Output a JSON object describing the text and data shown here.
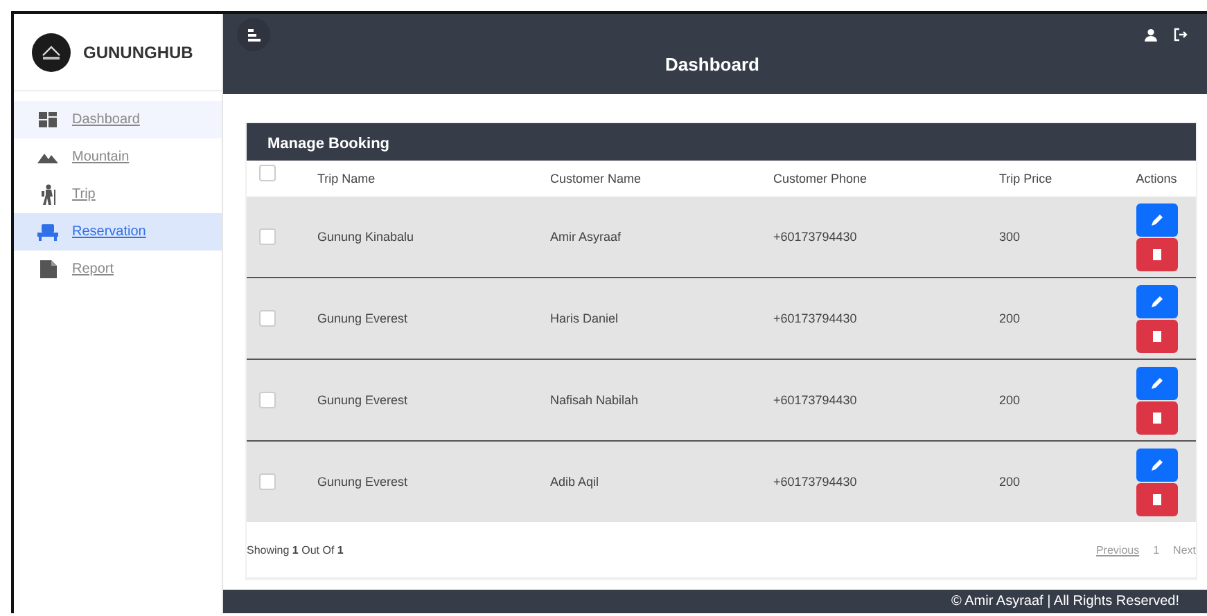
{
  "sidebar": {
    "brand": "GUNUNGHUB",
    "items": [
      {
        "kind": "dashboard",
        "label": "Dashboard",
        "selected": false,
        "hovered": true
      },
      {
        "kind": "mountain",
        "label": "Mountain",
        "selected": false,
        "hovered": false
      },
      {
        "kind": "trip",
        "label": "Trip",
        "selected": false,
        "hovered": false
      },
      {
        "kind": "reservation",
        "label": "Reservation",
        "selected": true,
        "hovered": false
      },
      {
        "kind": "report",
        "label": "Report",
        "selected": false,
        "hovered": false
      }
    ]
  },
  "header": {
    "title": "Dashboard"
  },
  "card": {
    "title": "Manage Booking",
    "columns": [
      "Trip Name",
      "Customer Name",
      "Customer Phone",
      "Trip Price",
      "Actions"
    ],
    "header_checked": false,
    "rows": [
      {
        "checked": false,
        "cells": [
          "Gunung Kinabalu",
          "Amir Asyraaf",
          "+60173794430",
          "300"
        ]
      },
      {
        "checked": false,
        "cells": [
          "Gunung Everest",
          "Haris Daniel",
          "+60173794430",
          "200"
        ]
      },
      {
        "checked": false,
        "cells": [
          "Gunung Everest",
          "Nafisah Nabilah",
          "+60173794430",
          "200"
        ]
      },
      {
        "checked": false,
        "cells": [
          "Gunung Everest",
          "Adib Aqil",
          "+60173794430",
          "200"
        ]
      }
    ],
    "showing": "Showing **1** Out Of **1**",
    "pagination": {
      "previous": "Previous",
      "page": "1",
      "next": "Next"
    }
  },
  "footer": "© Amir Asyraaf | All Rights Reserved!"
}
